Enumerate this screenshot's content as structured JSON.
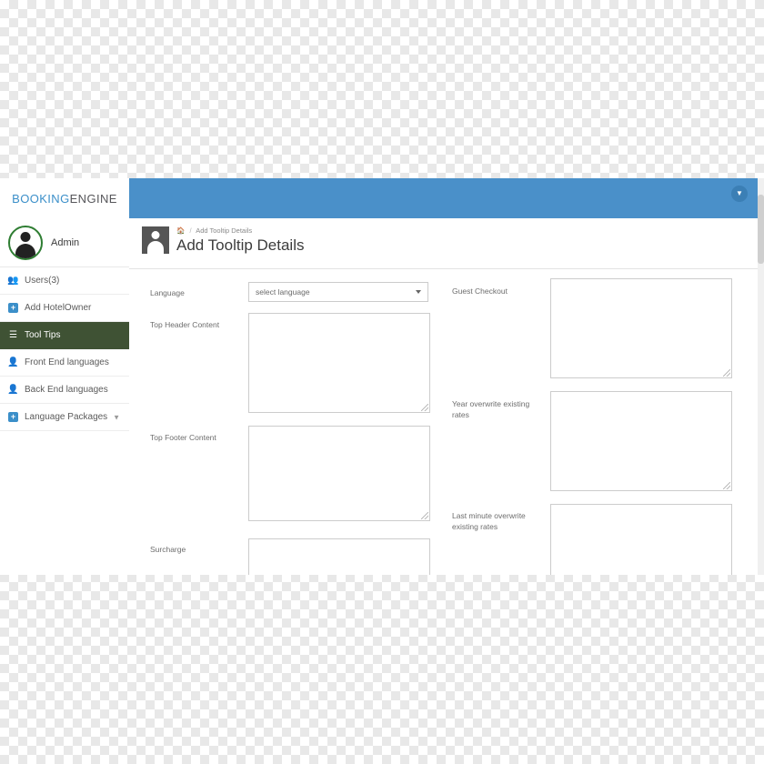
{
  "brand": {
    "part1": "BOOKING",
    "part2": "ENGINE"
  },
  "topbar": {
    "caret_icon": "chevron-down-icon"
  },
  "sidebar": {
    "profile": {
      "name": "Admin",
      "avatar_icon": "user-avatar-icon"
    },
    "items": [
      {
        "label": "Users(3)",
        "icon": "users-icon",
        "active": false,
        "caret": false
      },
      {
        "label": "Add HotelOwner",
        "icon": "plus-square-icon",
        "active": false,
        "caret": false
      },
      {
        "label": "Tool Tips",
        "icon": "bars-icon",
        "active": true,
        "caret": false
      },
      {
        "label": "Front End languages",
        "icon": "person-icon",
        "active": false,
        "caret": false
      },
      {
        "label": "Back End languages",
        "icon": "person-icon",
        "active": false,
        "caret": false
      },
      {
        "label": "Language Packages",
        "icon": "plus-square-icon",
        "active": false,
        "caret": true
      }
    ]
  },
  "page": {
    "breadcrumb_home_icon": "home-icon",
    "breadcrumb_current": "Add Tooltip Details",
    "breadcrumb_separator": "/",
    "title": "Add Tooltip Details",
    "header_icon": "user-card-icon"
  },
  "form": {
    "left": [
      {
        "label": "Language",
        "type": "select",
        "value": "select language"
      },
      {
        "label": "Top Header Content",
        "type": "textarea",
        "value": ""
      },
      {
        "label": "Top Footer Content",
        "type": "textarea",
        "value": ""
      },
      {
        "label": "Surcharge",
        "type": "textarea",
        "value": ""
      }
    ],
    "right": [
      {
        "label": "Guest Checkout",
        "type": "textarea",
        "value": ""
      },
      {
        "label": "Year overwrite existing rates",
        "type": "textarea",
        "value": ""
      },
      {
        "label": "Last minute overwrite existing rates",
        "type": "textarea",
        "value": ""
      }
    ]
  },
  "colors": {
    "topbar": "#4a90c9",
    "active_nav": "#3f5234",
    "accent": "#3b8fc9"
  }
}
